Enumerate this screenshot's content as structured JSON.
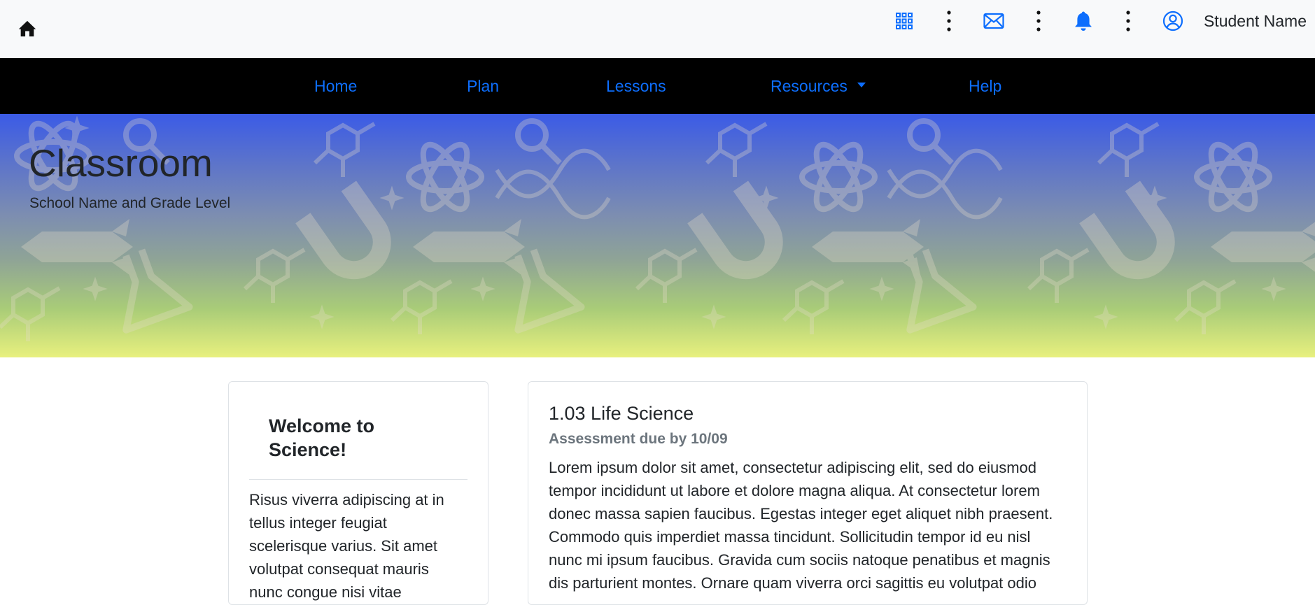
{
  "topbar": {
    "home_icon": "home-icon",
    "icons": [
      "apps-grid-icon",
      "mail-icon",
      "bell-icon",
      "user-circle-icon"
    ],
    "student_name": "Student Name"
  },
  "nav": {
    "items": [
      {
        "label": "Home"
      },
      {
        "label": "Plan"
      },
      {
        "label": "Lessons"
      },
      {
        "label": "Resources",
        "has_dropdown": true
      },
      {
        "label": "Help"
      }
    ],
    "link_color": "#0d6efd",
    "background": "#000000"
  },
  "hero": {
    "title": "Classroom",
    "subtitle": "School Name and Grade Level",
    "gradient_top": "#3b5be6",
    "gradient_bottom": "#e8f07e"
  },
  "welcome_card": {
    "title": "Welcome to Science!",
    "body": "Risus viverra adipiscing at in tellus integer feugiat scelerisque varius. Sit amet volutpat consequat mauris nunc congue nisi vitae"
  },
  "lesson_card": {
    "title": "1.03 Life Science",
    "subtitle": "Assessment due by 10/09",
    "body": "Lorem ipsum dolor sit amet, consectetur adipiscing elit, sed do eiusmod tempor incididunt ut labore et dolore magna aliqua. At consectetur lorem donec massa sapien faucibus. Egestas integer eget aliquet nibh praesent. Commodo quis imperdiet massa tincidunt. Sollicitudin tempor id eu nisl nunc mi ipsum faucibus. Gravida cum sociis natoque penatibus et magnis dis parturient montes. Ornare quam viverra orci sagittis eu volutpat odio"
  }
}
